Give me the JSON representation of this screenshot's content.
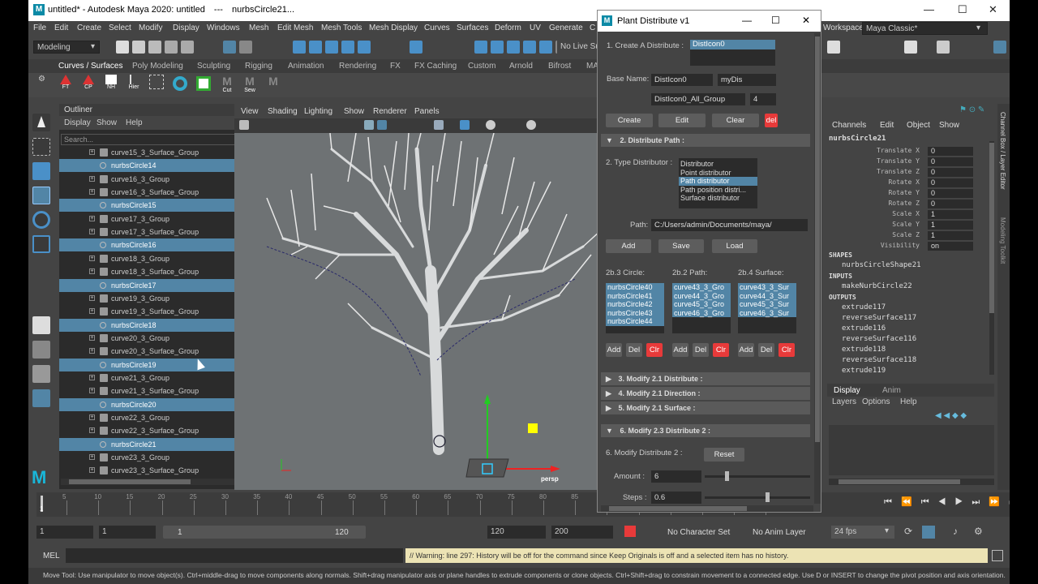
{
  "title": {
    "app": "untitled* - Autodesk Maya 2020: untitled",
    "sep": "---",
    "doc": "nurbsCircle21..."
  },
  "menubar": [
    "File",
    "Edit",
    "Create",
    "Select",
    "Modify",
    "Display",
    "Windows",
    "Mesh",
    "Edit Mesh",
    "Mesh Tools",
    "Mesh Display",
    "Curves",
    "Surfaces",
    "Deform",
    "UV",
    "Generate",
    "C"
  ],
  "workspace": {
    "label": "Workspace :",
    "value": "Maya Classic*"
  },
  "toolbar": {
    "mode": "Modeling",
    "live": "No Live Su"
  },
  "shelf_tabs": [
    "Curves / Surfaces",
    "Poly Modeling",
    "Sculpting",
    "Rigging",
    "Animation",
    "Rendering",
    "FX",
    "FX Caching",
    "Custom",
    "Arnold",
    "Bifrost",
    "MA"
  ],
  "shelf_buttons": [
    "FT",
    "CP",
    "NH",
    "Hier",
    "",
    "",
    "Cut",
    "Sew"
  ],
  "outliner": {
    "title": "Outliner",
    "menu": [
      "Display",
      "Show",
      "Help"
    ],
    "search_placeholder": "Search...",
    "rows": [
      {
        "label": "curve15_3_Surface_Group",
        "kind": "group",
        "sel": false
      },
      {
        "label": "nurbsCircle14",
        "kind": "circle",
        "sel": true
      },
      {
        "label": "curve16_3_Group",
        "kind": "group",
        "sel": false
      },
      {
        "label": "curve16_3_Surface_Group",
        "kind": "group",
        "sel": false
      },
      {
        "label": "nurbsCircle15",
        "kind": "circle",
        "sel": true
      },
      {
        "label": "curve17_3_Group",
        "kind": "group",
        "sel": false
      },
      {
        "label": "curve17_3_Surface_Group",
        "kind": "group",
        "sel": false
      },
      {
        "label": "nurbsCircle16",
        "kind": "circle",
        "sel": true
      },
      {
        "label": "curve18_3_Group",
        "kind": "group",
        "sel": false
      },
      {
        "label": "curve18_3_Surface_Group",
        "kind": "group",
        "sel": false
      },
      {
        "label": "nurbsCircle17",
        "kind": "circle",
        "sel": true
      },
      {
        "label": "curve19_3_Group",
        "kind": "group",
        "sel": false
      },
      {
        "label": "curve19_3_Surface_Group",
        "kind": "group",
        "sel": false
      },
      {
        "label": "nurbsCircle18",
        "kind": "circle",
        "sel": true
      },
      {
        "label": "curve20_3_Group",
        "kind": "group",
        "sel": false
      },
      {
        "label": "curve20_3_Surface_Group",
        "kind": "group",
        "sel": false
      },
      {
        "label": "nurbsCircle19",
        "kind": "circle",
        "sel": true
      },
      {
        "label": "curve21_3_Group",
        "kind": "group",
        "sel": false
      },
      {
        "label": "curve21_3_Surface_Group",
        "kind": "group",
        "sel": false
      },
      {
        "label": "nurbsCircle20",
        "kind": "circle",
        "sel": true
      },
      {
        "label": "curve22_3_Group",
        "kind": "group",
        "sel": false
      },
      {
        "label": "curve22_3_Surface_Group",
        "kind": "group",
        "sel": false
      },
      {
        "label": "nurbsCircle21",
        "kind": "circle",
        "sel": true
      },
      {
        "label": "curve23_3_Group",
        "kind": "group",
        "sel": false
      },
      {
        "label": "curve23_3_Surface_Group",
        "kind": "group",
        "sel": false
      }
    ]
  },
  "viewport": {
    "menu": [
      "View",
      "Shading",
      "Lighting",
      "Show",
      "Renderer",
      "Panels"
    ],
    "camera": "persp"
  },
  "plant": {
    "title": "Plant Distribute v1",
    "create_label": "1. Create A Distribute :",
    "create_value": "DistIcon0",
    "base_label": "Base Name:",
    "base_value": "DistIcon0",
    "base_value2": "myDis",
    "group_value": "DistIcon0_All_Group",
    "group_num": "4",
    "btn_create": "Create",
    "btn_edit": "Edit",
    "btn_clear": "Clear",
    "btn_del": "del",
    "sec2": "2. Distribute Path :",
    "type_label": "2. Type Distributor :",
    "types": [
      "Distributor",
      "Point distributor",
      "Path distributor",
      "Path position distri...",
      "Surface distributor"
    ],
    "type_selected": 2,
    "path_label": "Path:",
    "path_value": "C:/Users/admin/Documents/maya/",
    "btn_add": "Add",
    "btn_save": "Save",
    "btn_load": "Load",
    "list1_label": "2b.3 Circle:",
    "list2_label": "2b.2 Path:",
    "list3_label": "2b.4 Surface:",
    "list1": [
      "nurbsCircle40",
      "nurbsCircle41",
      "nurbsCircle42",
      "nurbsCircle43",
      "nurbsCircle44"
    ],
    "list2": [
      "curve43_3_Gro",
      "curve44_3_Gro",
      "curve45_3_Gro",
      "curve46_3_Gro"
    ],
    "list3": [
      "curve43_3_Sur",
      "curve44_3_Sur",
      "curve45_3_Sur",
      "curve46_3_Sur"
    ],
    "small_add": "Add",
    "small_del": "Del",
    "small_clr": "Clr",
    "sec3": "3. Modify 2.1 Distribute :",
    "sec4": "4. Modify 2.1 Direction :",
    "sec5": "5. Modify 2.1 Surface :",
    "sec6": "6. Modify 2.3 Distribute 2 :",
    "mod_label": "6. Modify Distribute 2 :",
    "btn_reset": "Reset",
    "amount_label": "Amount :",
    "amount_value": "6",
    "amount_slider": 0.2,
    "steps_label": "Steps :",
    "steps_value": "0.6",
    "steps_slider": 0.6
  },
  "channelbox": {
    "menu": [
      "Channels",
      "Edit",
      "Object",
      "Show"
    ],
    "object": "nurbsCircle21",
    "attrs": [
      {
        "name": "Translate X",
        "value": "0"
      },
      {
        "name": "Translate Y",
        "value": "0"
      },
      {
        "name": "Translate Z",
        "value": "0"
      },
      {
        "name": "Rotate X",
        "value": "0"
      },
      {
        "name": "Rotate Y",
        "value": "0"
      },
      {
        "name": "Rotate Z",
        "value": "0"
      },
      {
        "name": "Scale X",
        "value": "1"
      },
      {
        "name": "Scale Y",
        "value": "1"
      },
      {
        "name": "Scale Z",
        "value": "1"
      },
      {
        "name": "Visibility",
        "value": "on"
      }
    ],
    "shapes_hdr": "SHAPES",
    "shapes": [
      "nurbsCircleShape21"
    ],
    "inputs_hdr": "INPUTS",
    "inputs": [
      "makeNurbCircle22"
    ],
    "outputs_hdr": "OUTPUTS",
    "outputs": [
      "extrude117",
      "reverseSurface117",
      "extrude116",
      "reverseSurface116",
      "extrude118",
      "reverseSurface118",
      "extrude119"
    ],
    "layer_tabs": [
      "Display",
      "Anim"
    ],
    "layer_menu": [
      "Layers",
      "Options",
      "Help"
    ],
    "side_tabs": [
      "Channel Box / Layer Editor",
      "Modeling Toolkit"
    ]
  },
  "timeline": {
    "ticks": [
      "5",
      "10",
      "15",
      "20",
      "25",
      "30",
      "35",
      "40",
      "45",
      "50",
      "55",
      "60",
      "65",
      "70",
      "75",
      "80",
      "85",
      "90",
      "95",
      "100",
      "105",
      "110",
      "115"
    ],
    "current": "1"
  },
  "range": {
    "start": "1",
    "start2": "1",
    "slider_start": "1",
    "slider_end": "120",
    "end": "120",
    "end2": "200",
    "character": "No Character Set",
    "anim_layer": "No Anim Layer",
    "fps": "24 fps"
  },
  "mel": {
    "label": "MEL",
    "warning": "// Warning: line 297: History will be off for the command since Keep Originals is off and a selected item has no history."
  },
  "status": "Move Tool: Use manipulator to move object(s). Ctrl+middle-drag to move components along normals. Shift+drag manipulator axis or plane handles to extrude components or clone objects. Ctrl+Shift+drag to constrain movement to a connected edge. Use D or INSERT to change the pivot position and axis orientation.",
  "colors": {
    "select": "#5285a6",
    "accent_red": "#e83a3a",
    "warning": "#ece3b4"
  }
}
